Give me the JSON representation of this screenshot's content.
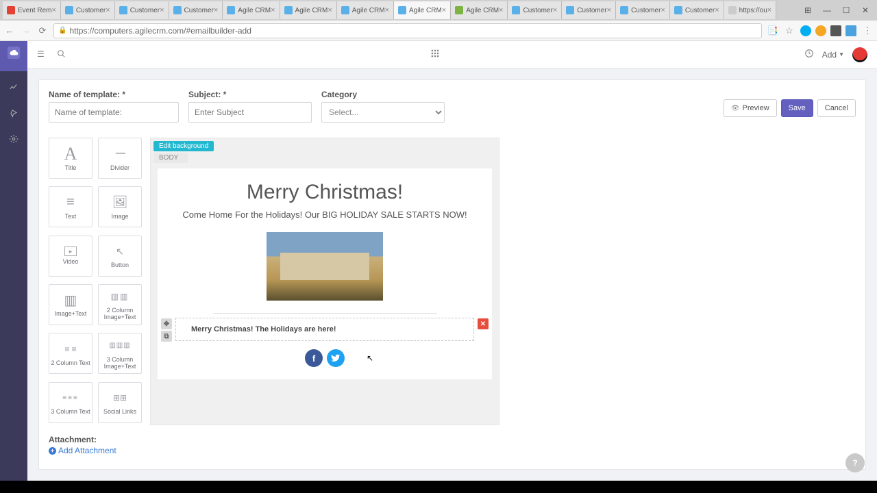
{
  "browser": {
    "tabs": [
      {
        "label": "Event Rem",
        "icon": "#e34133"
      },
      {
        "label": "Customer",
        "icon": "#5ab0e8"
      },
      {
        "label": "Customer",
        "icon": "#5ab0e8"
      },
      {
        "label": "Customer",
        "icon": "#5ab0e8"
      },
      {
        "label": "Agile CRM",
        "icon": "#5ab0e8"
      },
      {
        "label": "Agile CRM",
        "icon": "#5ab0e8"
      },
      {
        "label": "Agile CRM",
        "icon": "#5ab0e8"
      },
      {
        "label": "Agile CRM",
        "icon": "#5ab0e8",
        "active": true
      },
      {
        "label": "Agile CRM",
        "icon": "#7cb342"
      },
      {
        "label": "Customer",
        "icon": "#5ab0e8"
      },
      {
        "label": "Customer",
        "icon": "#5ab0e8"
      },
      {
        "label": "Customer",
        "icon": "#5ab0e8"
      },
      {
        "label": "Customer",
        "icon": "#5ab0e8"
      },
      {
        "label": "https://ou",
        "icon": "#ccc"
      }
    ],
    "url": "https://computers.agilecrm.com/#emailbuilder-add"
  },
  "topbar": {
    "add_label": "Add"
  },
  "form": {
    "template_label": "Name of template: *",
    "template_placeholder": "Name of template:",
    "subject_label": "Subject: *",
    "subject_placeholder": "Enter Subject",
    "category_label": "Category",
    "category_placeholder": "Select..."
  },
  "actions": {
    "preview": "Preview",
    "save": "Save",
    "cancel": "Cancel"
  },
  "blocks": [
    {
      "label": "Title",
      "glyph": "A",
      "style": "font-family:Georgia;font-size:26px;"
    },
    {
      "label": "Divider",
      "glyph": "─",
      "style": "letter-spacing:-2px;"
    },
    {
      "label": "Text",
      "glyph": "≡",
      "style": ""
    },
    {
      "label": "Image",
      "glyph": "🖼",
      "style": "font-size:18px;"
    },
    {
      "label": "Video",
      "glyph": "▸",
      "style": "border:1px solid #aaa;width:18px;height:14px;font-size:9px;"
    },
    {
      "label": "Button",
      "glyph": "↖",
      "style": "font-size:14px;"
    },
    {
      "label": "Image+Text",
      "glyph": "▥",
      "style": ""
    },
    {
      "label": "2 Column Image+Text",
      "glyph": "▥▥",
      "style": "font-size:12px;letter-spacing:2px;"
    },
    {
      "label": "2 Column Text",
      "glyph": "≡ ≡",
      "style": "font-size:12px;"
    },
    {
      "label": "3 Column Image+Text",
      "glyph": "▥▥▥",
      "style": "font-size:10px;letter-spacing:1px;"
    },
    {
      "label": "3 Column Text",
      "glyph": "≡≡≡",
      "style": "font-size:10px;letter-spacing:2px;"
    },
    {
      "label": "Social Links",
      "glyph": "⊞⊞",
      "style": "font-size:12px;"
    }
  ],
  "canvas": {
    "edit_bg": "Edit background",
    "body_tab": "BODY",
    "title": "Merry Christmas!",
    "subtitle": "Come Home For the Holidays!  Our BIG HOLIDAY SALE STARTS NOW!",
    "text_block": "Merry Christmas!  The Holidays are here!"
  },
  "attach": {
    "label": "Attachment:",
    "link": "Add Attachment"
  }
}
